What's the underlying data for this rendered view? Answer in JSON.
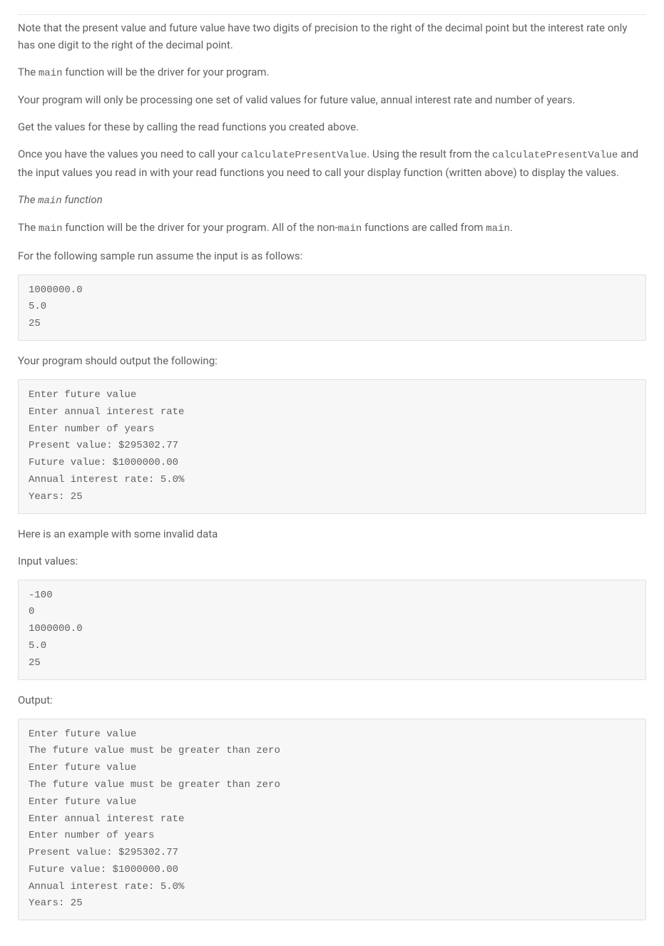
{
  "paragraphs": {
    "p1": "Note that the present value and future value have two digits of precision to the right of the decimal point but the interest rate only has one digit to the right of the decimal point.",
    "p2_pre": "The ",
    "p2_mono": "main",
    "p2_post": " function will be the driver for your program.",
    "p3": "Your program will only be processing one set of valid values for future value, annual interest rate and number of years.",
    "p4": "Get the values for these by calling the read functions you created above.",
    "p5_a": "Once you have the values you need to call your ",
    "p5_m1": "calculatePresentValue",
    "p5_b": ". Using the result from the ",
    "p5_m2": "calculatePresentValue",
    "p5_c": " and the input values you read in with your read functions you need to call your display function (written above) to display the values.",
    "p6_pre": "The ",
    "p6_mono": "main",
    "p6_post": " function",
    "p7_a": "The ",
    "p7_m1": "main",
    "p7_b": " function will be the driver for your program. All of the non-",
    "p7_m2": "main",
    "p7_c": " functions are called from ",
    "p7_m3": "main",
    "p7_d": ".",
    "p8": "For the following sample run assume the input is as follows:",
    "p9": "Your program should output the following:",
    "p10": "Here is an example with some invalid data",
    "p11": "Input values:",
    "p12": "Output:"
  },
  "code": {
    "block1": "1000000.0\n5.0\n25",
    "block2": "Enter future value\nEnter annual interest rate\nEnter number of years\nPresent value: $295302.77\nFuture value: $1000000.00\nAnnual interest rate: 5.0%\nYears: 25",
    "block3": "-100\n0\n1000000.0\n5.0\n25",
    "block4": "Enter future value\nThe future value must be greater than zero\nEnter future value\nThe future value must be greater than zero\nEnter future value\nEnter annual interest rate\nEnter number of years\nPresent value: $295302.77\nFuture value: $1000000.00\nAnnual interest rate: 5.0%\nYears: 25"
  }
}
